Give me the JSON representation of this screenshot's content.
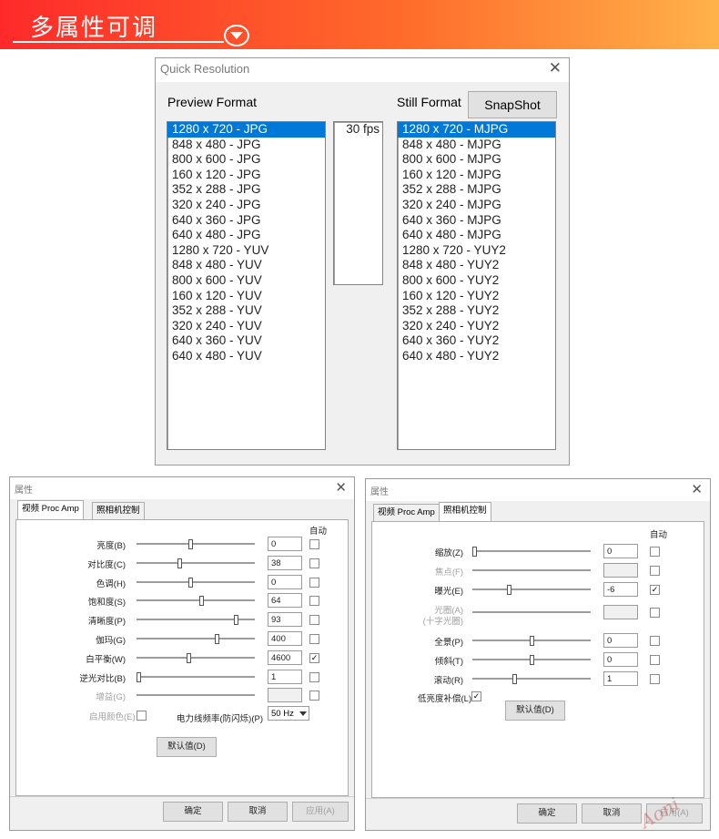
{
  "banner": {
    "title": "多属性可调"
  },
  "quick_resolution": {
    "title": "Quick Resolution",
    "preview_label": "Preview Format",
    "still_label": "Still Format",
    "snapshot_label": "SnapShot",
    "preview_items": [
      "1280 x 720 - JPG",
      "848 x 480 - JPG",
      "800 x 600 - JPG",
      "160 x 120 - JPG",
      "352 x 288 - JPG",
      "320 x 240 - JPG",
      "640 x 360 - JPG",
      "640 x 480 - JPG",
      "1280 x 720 - YUV",
      "848 x 480 - YUV",
      "800 x 600 - YUV",
      "160 x 120 - YUV",
      "352 x 288 - YUV",
      "320 x 240 - YUV",
      "640 x 360 - YUV",
      "640 x 480 - YUV"
    ],
    "fps_items": [
      "30 fps"
    ],
    "still_items": [
      "1280 x 720 - MJPG",
      "848 x 480 - MJPG",
      "800 x 600 - MJPG",
      "160 x 120 - MJPG",
      "352 x 288 - MJPG",
      "320 x 240 - MJPG",
      "640 x 360 - MJPG",
      "640 x 480 - MJPG",
      "1280 x 720 - YUY2",
      "848 x 480 - YUY2",
      "800 x 600 - YUY2",
      "160 x 120 - YUY2",
      "352 x 288 - YUY2",
      "320 x 240 - YUY2",
      "640 x 360 - YUY2",
      "640 x 480 - YUY2"
    ],
    "selected_index": 0
  },
  "proc_amp": {
    "title": "属性",
    "tab_video": "视频 Proc Amp",
    "tab_camera": "照相机控制",
    "auto_label": "自动",
    "rows": [
      {
        "label": "亮度(B)",
        "value": "0",
        "level": 0.45,
        "auto": false,
        "disabled": false
      },
      {
        "label": "对比度(C)",
        "value": "38",
        "level": 0.36,
        "auto": false,
        "disabled": false
      },
      {
        "label": "色调(H)",
        "value": "0",
        "level": 0.45,
        "auto": false,
        "disabled": false
      },
      {
        "label": "饱和度(S)",
        "value": "64",
        "level": 0.55,
        "auto": false,
        "disabled": false
      },
      {
        "label": "清晰度(P)",
        "value": "93",
        "level": 0.85,
        "auto": false,
        "disabled": false
      },
      {
        "label": "伽玛(G)",
        "value": "400",
        "level": 0.68,
        "auto": false,
        "disabled": false
      },
      {
        "label": "白平衡(W)",
        "value": "4600",
        "level": 0.44,
        "auto": true,
        "disabled": false
      },
      {
        "label": "逆光对比(B)",
        "value": "1",
        "level": 0.0,
        "auto": false,
        "disabled": false
      },
      {
        "label": "增益(G)",
        "value": "",
        "level": 0.0,
        "auto": false,
        "disabled": true
      }
    ],
    "color_enable_label": "启用颜色(E)",
    "powerline_label": "电力线频率(防闪烁)(P)",
    "powerline_value": "50 Hz",
    "default_label": "默认值(D)",
    "ok_label": "确定",
    "cancel_label": "取消",
    "apply_label": "应用(A)"
  },
  "camera_control": {
    "title": "属性",
    "tab_video": "视频 Proc Amp",
    "tab_camera": "照相机控制",
    "auto_label": "自动",
    "rows": [
      {
        "label": "缩放(Z)",
        "value": "0",
        "level": 0.0,
        "auto": false,
        "disabled": false
      },
      {
        "label": "焦点(F)",
        "value": "",
        "level": 0.0,
        "auto": false,
        "disabled": true
      },
      {
        "label": "曝光(E)",
        "value": "-6",
        "level": 0.3,
        "auto": true,
        "disabled": false
      },
      {
        "label": "光圈(A)",
        "label2": "(十字光圈)",
        "value": "",
        "level": 0.0,
        "auto": false,
        "disabled": true
      },
      {
        "label": "全景(P)",
        "value": "0",
        "level": 0.5,
        "auto": false,
        "disabled": false
      },
      {
        "label": "倾斜(T)",
        "value": "0",
        "level": 0.5,
        "auto": false,
        "disabled": false
      },
      {
        "label": "滚动(R)",
        "value": "1",
        "level": 0.35,
        "auto": false,
        "disabled": false
      }
    ],
    "low_light_label": "低亮度补偿(L)",
    "default_label": "默认值(D)",
    "ok_label": "确定",
    "cancel_label": "取消",
    "apply_label": "应用(A)"
  },
  "watermark": "Aoni"
}
